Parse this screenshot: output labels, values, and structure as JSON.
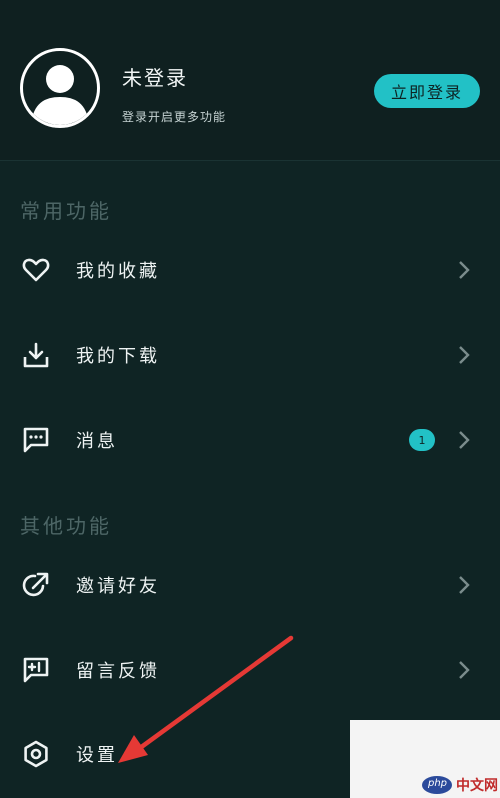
{
  "profile": {
    "name": "未登录",
    "subtitle": "登录开启更多功能",
    "login_button": "立即登录"
  },
  "sections": [
    {
      "title": "常用功能",
      "items": [
        {
          "label": "我的收藏",
          "icon": "heart-icon"
        },
        {
          "label": "我的下载",
          "icon": "download-icon"
        },
        {
          "label": "消息",
          "icon": "message-icon",
          "badge": "1"
        }
      ]
    },
    {
      "title": "其他功能",
      "items": [
        {
          "label": "邀请好友",
          "icon": "share-icon"
        },
        {
          "label": "留言反馈",
          "icon": "feedback-icon"
        },
        {
          "label": "设置",
          "icon": "gear-icon"
        }
      ]
    }
  ],
  "colors": {
    "background": "#0f2424",
    "accent": "#22c1c6",
    "annotation": "#e53935"
  },
  "watermark": {
    "logo_text": "php",
    "site_text": "中文网"
  }
}
